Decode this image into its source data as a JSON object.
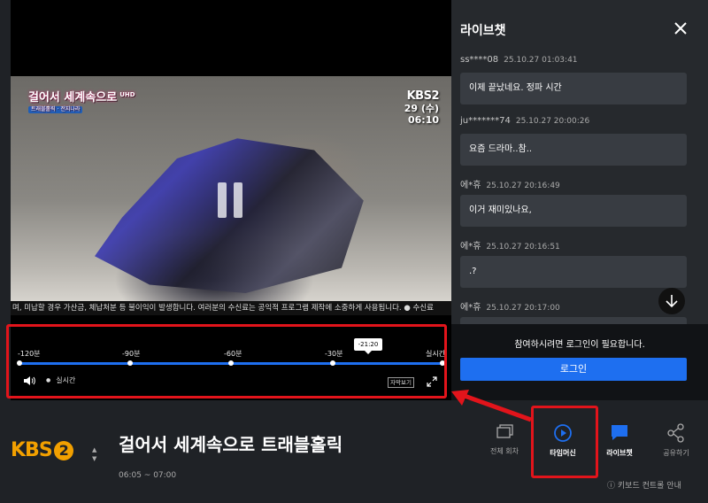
{
  "video": {
    "show_logo": "걸어서 세계속으로",
    "show_logo_badge": "UHD",
    "show_logo_sub": "트래블홀릭 · 전지나라",
    "channel_bug": "KBS2",
    "bug_date": "29 (수)",
    "bug_time": "06:10",
    "ticker": "며, 미납할 경우 가산금, 체납처분 등 불이익이 발생합니다. 여러분의 수신료는 공익적 프로그램 제작에 소중하게 사용됩니다.  ● 수신료 ",
    "timemachine": {
      "labels": [
        "-120분",
        "-90분",
        "-60분",
        "-30분",
        "실시간"
      ],
      "position_label": "-21:20",
      "live_label": "실시간",
      "subtitle_button": "자막보기"
    }
  },
  "chat": {
    "title": "라이브챗",
    "messages": [
      {
        "user": "ss****08",
        "time": "25.10.27 01:03:41",
        "text": "이제 끝났네요. 정파 시간"
      },
      {
        "user": "ju*******74",
        "time": "25.10.27 20:00:26",
        "text": "요즘 드라마..참.."
      },
      {
        "user": "에*휴",
        "time": "25.10.27 20:16:49",
        "text": "이거 재미있나요,"
      },
      {
        "user": "에*휴",
        "time": "25.10.27 20:16:51",
        "text": ".?"
      },
      {
        "user": "에*휴",
        "time": "25.10.27 20:17:00",
        "text": ""
      }
    ],
    "login_message": "참여하시려면 로그인이 필요합니다.",
    "login_button": "로그인"
  },
  "info": {
    "channel_logo": "KBS",
    "channel_number": "2",
    "program_title": "걸어서 세계속으로 트래블홀릭",
    "program_time": "06:05 ~ 07:00",
    "tools": {
      "episodes": "전체 회차",
      "timemachine": "타임머신",
      "livechat": "라이브챗",
      "share": "공유하기"
    },
    "keyboard_guide": "키보드 컨트롤 안내"
  },
  "colors": {
    "accent": "#1e6ff0",
    "highlight": "#e2141b",
    "kbs_orange": "#f2a000"
  }
}
